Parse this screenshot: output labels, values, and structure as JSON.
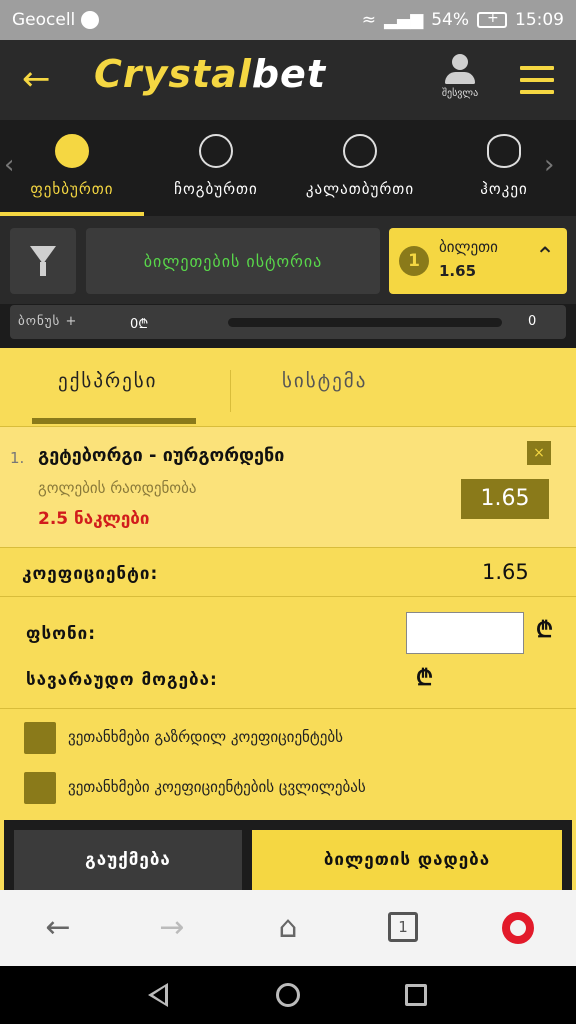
{
  "status_bar": {
    "carrier": "Geocell",
    "battery": "54%",
    "time": "15:09"
  },
  "header": {
    "logo_part1": "Crystal",
    "logo_part2": "bet",
    "user_label": "შესვლა"
  },
  "sports": [
    {
      "label": "ფეხბურთი",
      "icon": "soccer-ball-icon",
      "active": true
    },
    {
      "label": "ჩოგბურთი",
      "icon": "tennis-ball-icon",
      "active": false
    },
    {
      "label": "კალათბურთი",
      "icon": "basketball-icon",
      "active": false
    },
    {
      "label": "ჰოკეი",
      "icon": "hockey-puck-icon",
      "active": false
    }
  ],
  "toolbar": {
    "history_label": "ბილეთების ისტორია",
    "ticket_count": "1",
    "ticket_label": "ბილეთი",
    "ticket_odds": "1.65"
  },
  "bonus": {
    "label": "ბონუს +",
    "value": "0₾",
    "count": "0"
  },
  "slip": {
    "tab_express": "ექსპრესი",
    "tab_system": "სისტემა",
    "event": {
      "number": "1.",
      "title": "გეტებორგი - იურგორდენი",
      "market": "გოლების რაოდენობა",
      "selection": "2.5 ნაკლები",
      "odds": "1.65",
      "close": "×"
    },
    "coef_label": "კოეფიციენტი:",
    "coef_value": "1.65",
    "stake_label": "ფსონი:",
    "stake_value": "",
    "currency": "₾",
    "win_label": "სავარაუდო მოგება:",
    "check1": "ვეთანხმები გაზრდილ კოეფიციენტებს",
    "check2": "ვეთანხმები კოეფიციენტების ცვლილებას",
    "cancel": "გაუქმება",
    "place": "ბილეთის დადება"
  },
  "browser": {
    "tab_count": "1"
  }
}
